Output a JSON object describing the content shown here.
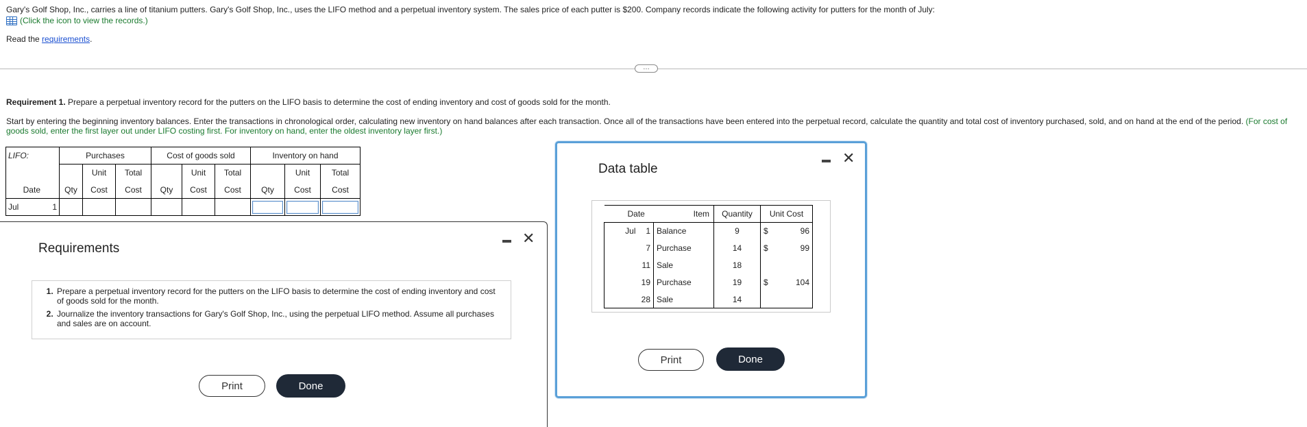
{
  "intro": {
    "problem_text": "Gary's Golf Shop, Inc., carries a line of titanium putters. Gary's Golf Shop, Inc., uses the LIFO method and a perpetual inventory system. The sales price of each putter is $200. Company records indicate the following activity for putters for the month of July:",
    "records_link": "(Click the icon to view the records.)",
    "read_the": "Read the",
    "requirements_link": "requirements",
    "period": "."
  },
  "expand_button": "…",
  "requirement1": {
    "label": "Requirement 1.",
    "text": "Prepare a perpetual inventory record for the putters on the LIFO basis to determine the cost of ending inventory and cost of goods sold for the month."
  },
  "instructions": {
    "text": "Start by entering the beginning inventory balances. Enter the transactions in chronological order, calculating new inventory on hand balances after each transaction. Once all of the transactions have been entered into the perpetual record, calculate the quantity and total cost of inventory purchased, sold, and on hand at the end of the period.",
    "hint": "(For cost of goods sold, enter the first layer out under LIFO costing first. For inventory on hand, enter the oldest inventory layer first.)"
  },
  "lifo_table": {
    "label": "LIFO:",
    "groups": [
      "Purchases",
      "Cost of goods sold",
      "Inventory on hand"
    ],
    "unit_label": "Unit",
    "total_label": "Total",
    "date_label": "Date",
    "qty_label": "Qty",
    "cost_label": "Cost",
    "row": {
      "month": "Jul",
      "day": "1"
    }
  },
  "requirements_window": {
    "title": "Requirements",
    "items": [
      "Prepare a perpetual inventory record for the putters on the LIFO basis to determine the cost of ending inventory and cost of goods sold for the month.",
      "Journalize the inventory transactions for Gary's Golf Shop, Inc., using the perpetual LIFO method. Assume all purchases and sales are on account."
    ],
    "print_label": "Print",
    "done_label": "Done"
  },
  "data_window": {
    "title": "Data table",
    "headers": [
      "Date",
      "Item",
      "Quantity",
      "Unit Cost"
    ],
    "month": "Jul",
    "rows": [
      {
        "day": "1",
        "item": "Balance",
        "qty": "9",
        "cur": "$",
        "cost": "96"
      },
      {
        "day": "7",
        "item": "Purchase",
        "qty": "14",
        "cur": "$",
        "cost": "99"
      },
      {
        "day": "11",
        "item": "Sale",
        "qty": "18",
        "cur": "",
        "cost": ""
      },
      {
        "day": "19",
        "item": "Purchase",
        "qty": "19",
        "cur": "$",
        "cost": "104"
      },
      {
        "day": "28",
        "item": "Sale",
        "qty": "14",
        "cur": "",
        "cost": ""
      }
    ],
    "print_label": "Print",
    "done_label": "Done"
  },
  "colors": {
    "accent_green": "#1a7a2e",
    "link_blue": "#1a4fd1",
    "window_border": "#5aa0d8",
    "done_button": "#1f2937"
  }
}
